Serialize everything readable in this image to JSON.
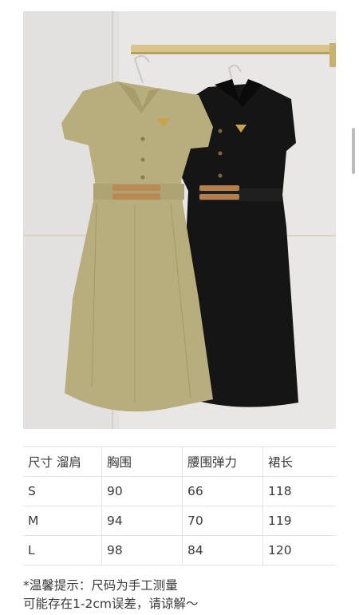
{
  "product_photo": {
    "alt": "",
    "dress_colors": {
      "left": "#b8ad7c",
      "right": "#141414",
      "belt": "#b8814d",
      "wall": "#e7e6e4"
    }
  },
  "size_table": {
    "headers": [
      "尺寸 溜肩",
      "胸围",
      "腰围弹力",
      "裙长"
    ],
    "rows": [
      [
        "S",
        "90",
        "66",
        "118"
      ],
      [
        "M",
        "94",
        "70",
        "119"
      ],
      [
        "L",
        "98",
        "84",
        "120"
      ]
    ]
  },
  "note": {
    "line1": "*温馨提示：尺码为手工测量",
    "line2": "可能存在1-2cm误差，请谅解～"
  }
}
